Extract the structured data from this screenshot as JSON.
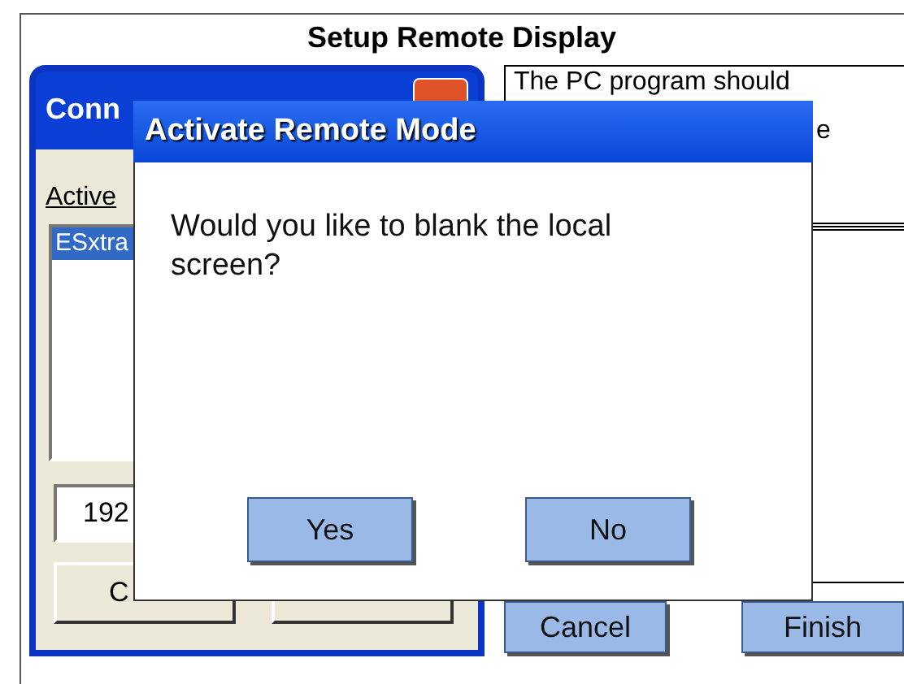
{
  "setup_window": {
    "title": "Setup Remote Display",
    "info_lines": [
      "The PC program should",
      "e"
    ],
    "buttons": [
      "Cancel",
      "Finish"
    ]
  },
  "connection_window": {
    "title": "Conn",
    "list_label": "Active",
    "list_items": [
      {
        "label": "ESxtra",
        "selected": true
      }
    ],
    "address_value": "192",
    "buttons": [
      "C"
    ]
  },
  "dialog": {
    "title": "Activate Remote Mode",
    "message": "Would you like to blank the local screen?",
    "buttons": [
      "Yes",
      "No"
    ]
  }
}
